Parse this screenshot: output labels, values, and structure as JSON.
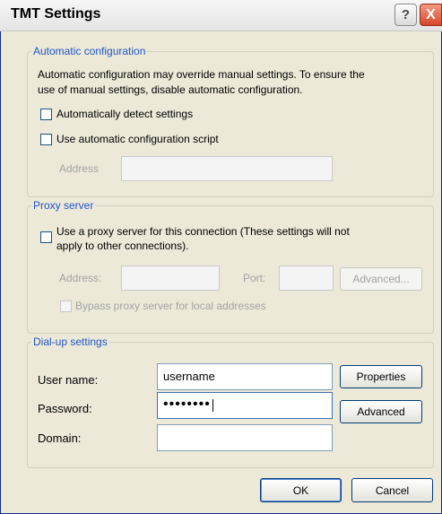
{
  "title": "TMT Settings",
  "titlebar": {
    "help_glyph": "?",
    "close_glyph": "X"
  },
  "auto": {
    "legend": "Automatic configuration",
    "description_line1": "Automatic configuration may override manual settings.  To ensure the",
    "description_line2": "use of manual settings, disable automatic configuration.",
    "detect_label": "Automatically detect settings",
    "script_label": "Use automatic configuration script",
    "address_label": "Address",
    "address_value": ""
  },
  "proxy": {
    "legend": "Proxy server",
    "use_label_line1": "Use a proxy server for this connection (These settings will not",
    "use_label_line2": "apply to other connections).",
    "address_label": "Address:",
    "address_value": "",
    "port_label": "Port:",
    "port_value": "",
    "advanced_label": "Advanced...",
    "bypass_label": "Bypass proxy server for local addresses"
  },
  "dialup": {
    "legend": "Dial-up settings",
    "username_label": "User name:",
    "username_value": "username",
    "password_label": "Password:",
    "password_value": "••••••••",
    "domain_label": "Domain:",
    "domain_value": "",
    "properties_label": "Properties",
    "advanced_label": "Advanced"
  },
  "buttons": {
    "ok": "OK",
    "cancel": "Cancel"
  }
}
